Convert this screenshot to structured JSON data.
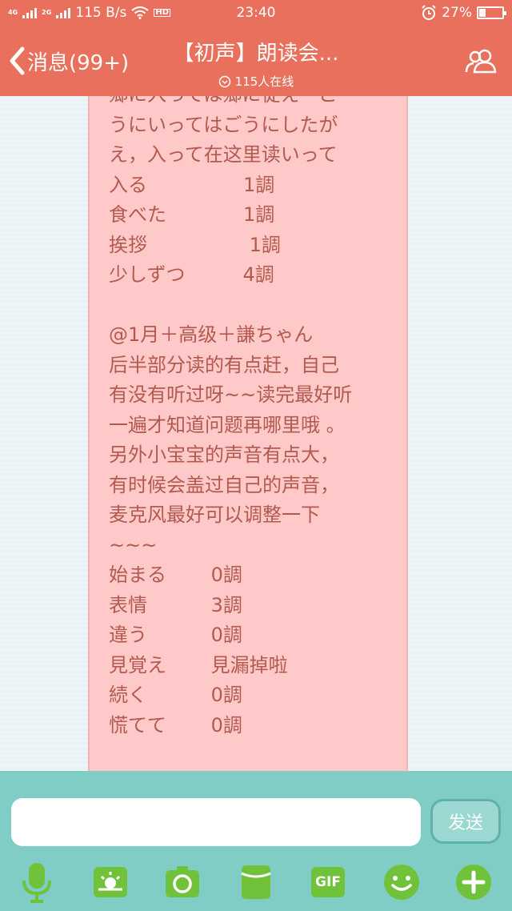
{
  "status_bar": {
    "net1": "4G",
    "net2": "2G",
    "speed": "115 B/s",
    "hd": "HD",
    "time": "23:40",
    "battery": "27%",
    "battery_level": 0.27
  },
  "header": {
    "back_label": "消息(99+)",
    "title": "【初声】朗读会...",
    "online": "115人在线"
  },
  "message": {
    "lines": [
      "郷に入っては郷に従え　ご",
      "うにいってはごうにしたが",
      "え，入って在这里读いって",
      "入る　　　　　1調",
      "食べた　　　　1調",
      "挨拶　　　　　 1調",
      "少しずつ　　　4調",
      "",
      "@1月＋高级＋謙ちゃん",
      "后半部分读的有点赶，自己",
      "有没有听过呀~~读完最好听",
      "一遍才知道问题再哪里哦 。",
      "另外小宝宝的声音有点大，",
      "有时候会盖过自己的声音，",
      "麦克风最好可以调整一下",
      "~~~",
      "始まる　　 0調",
      "表情　　　 3調",
      "違う　　　 0調",
      "見覚え　　 見漏掉啦",
      "続く　　　 0調",
      "慌てて　　 0調"
    ]
  },
  "composer": {
    "input_value": "",
    "send_label": "发送"
  },
  "toolbar": {
    "gif_label": "GIF"
  },
  "colors": {
    "header": "#e8705c",
    "bubble": "#ffc9c9",
    "bubble_text": "#b25a4e",
    "bottom": "#7fcdc5",
    "icon_green": "#6fc23a"
  }
}
